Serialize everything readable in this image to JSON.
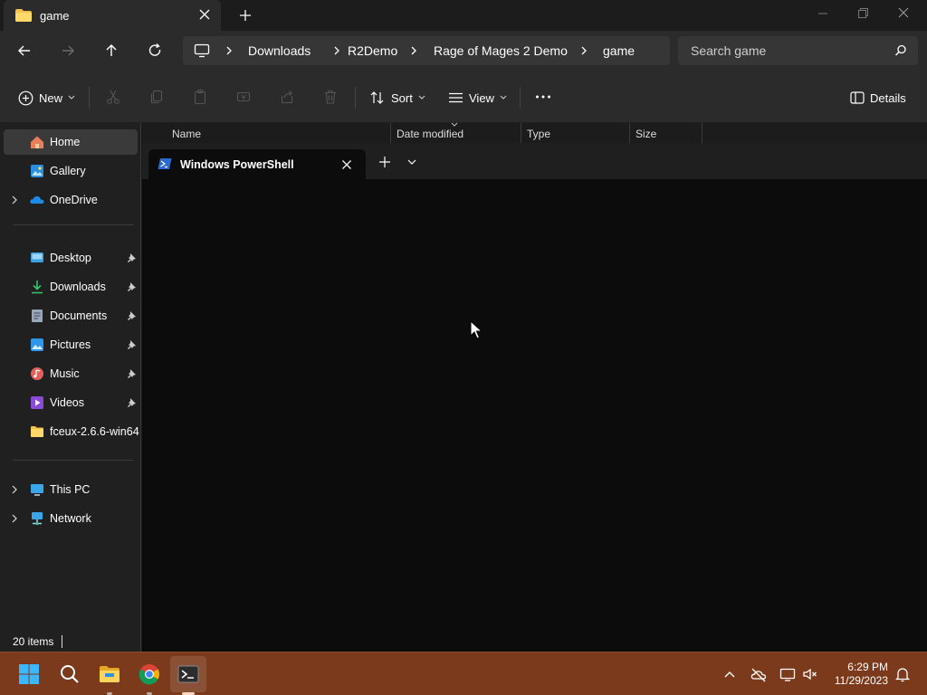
{
  "window": {
    "tab_title": "game",
    "new_tab_label": "+",
    "controls": [
      "minimize",
      "restore",
      "close"
    ]
  },
  "address": {
    "breadcrumbs": [
      "Downloads",
      "R2Demo",
      "Rage of Mages 2 Demo",
      "game"
    ]
  },
  "search": {
    "placeholder": "Search game"
  },
  "commandbar": {
    "new_label": "New",
    "sort_label": "Sort",
    "view_label": "View",
    "more_label": "...",
    "details_label": "Details"
  },
  "sidebar": {
    "group1": [
      {
        "label": "Home",
        "icon": "home-icon",
        "active": true
      },
      {
        "label": "Gallery",
        "icon": "gallery-icon"
      },
      {
        "label": "OneDrive",
        "icon": "onedrive-icon",
        "expandable": true
      }
    ],
    "quick_access": [
      {
        "label": "Desktop",
        "icon": "desktop-icon",
        "pinned": true
      },
      {
        "label": "Downloads",
        "icon": "downloads-icon",
        "pinned": true
      },
      {
        "label": "Documents",
        "icon": "documents-icon",
        "pinned": true
      },
      {
        "label": "Pictures",
        "icon": "pictures-icon",
        "pinned": true
      },
      {
        "label": "Music",
        "icon": "music-icon",
        "pinned": true
      },
      {
        "label": "Videos",
        "icon": "videos-icon",
        "pinned": true
      },
      {
        "label": "fceux-2.6.6-win64",
        "icon": "folder-icon"
      }
    ],
    "group3": [
      {
        "label": "This PC",
        "icon": "this-pc-icon",
        "expandable": true
      },
      {
        "label": "Network",
        "icon": "network-icon",
        "expandable": true
      }
    ]
  },
  "status": {
    "item_count": "20 items"
  },
  "list_header": {
    "columns": [
      "Name",
      "Date modified",
      "Type",
      "Size"
    ]
  },
  "terminal": {
    "tab_title": "Windows PowerShell"
  },
  "taskbar": {
    "apps": [
      "start-icon",
      "search-icon",
      "file-explorer-icon",
      "chrome-icon",
      "terminal-icon"
    ],
    "time": "6:29 PM",
    "date": "11/29/2023"
  },
  "colors": {
    "taskbar": "#7a3a1b",
    "explorer_bg": "#2b2b2b",
    "terminal_bg": "#0c0c0c",
    "accent": "#4cc2ff"
  }
}
